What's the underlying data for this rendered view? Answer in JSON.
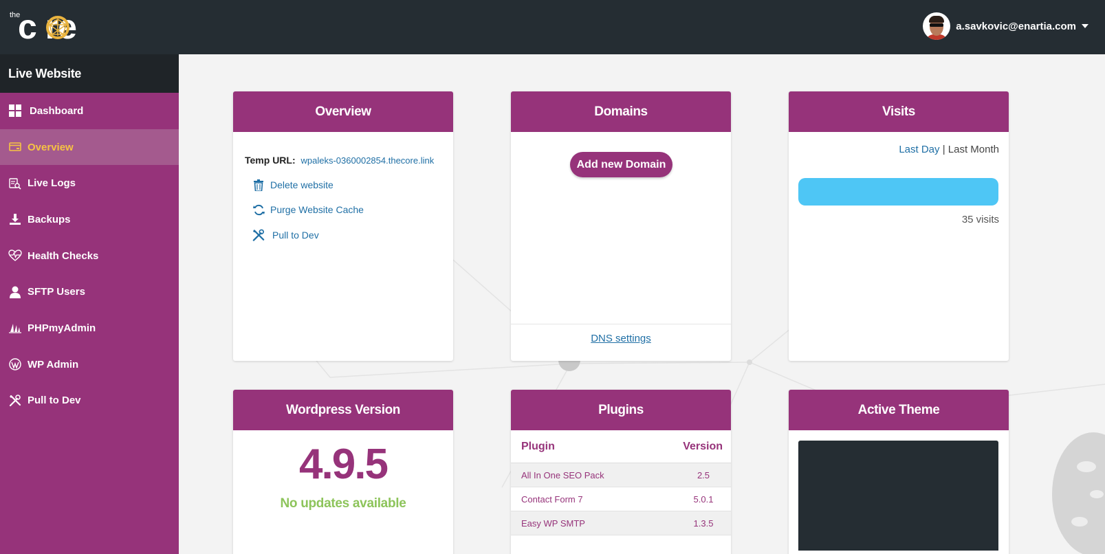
{
  "header": {
    "logo_the": "the",
    "logo_word": "c re",
    "user_email": "a.savkovic@enartia.com"
  },
  "sidebar": {
    "title": "Live Website",
    "items": [
      {
        "label": "Dashboard",
        "icon": "dashboard-grid-icon"
      },
      {
        "label": "Overview",
        "icon": "credit-card-icon",
        "active": true
      },
      {
        "label": "Live Logs",
        "icon": "logs-search-icon"
      },
      {
        "label": "Backups",
        "icon": "download-icon"
      },
      {
        "label": "Health Checks",
        "icon": "heartbeat-icon"
      },
      {
        "label": "SFTP Users",
        "icon": "user-icon"
      },
      {
        "label": "PHPmyAdmin",
        "icon": "sailboat-icon"
      },
      {
        "label": "WP Admin",
        "icon": "wordpress-icon"
      },
      {
        "label": "Pull to Dev",
        "icon": "tools-icon"
      }
    ]
  },
  "overview": {
    "title": "Overview",
    "temp_url_label": "Temp URL:",
    "temp_url": "wpaleks-0360002854.thecore.link",
    "actions": [
      {
        "label": "Delete website",
        "icon": "trash-icon"
      },
      {
        "label": "Purge Website Cache",
        "icon": "refresh-icon"
      },
      {
        "label": "Pull to Dev",
        "icon": "tools-icon"
      }
    ]
  },
  "domains": {
    "title": "Domains",
    "add_button": "Add new Domain",
    "dns_link": "DNS settings"
  },
  "visits": {
    "title": "Visits",
    "tab_day": "Last Day",
    "separator": "|",
    "tab_month": "Last Month",
    "count_text": "35 visits",
    "bar_fill": 1.0,
    "bar_color": "#4ec6f5"
  },
  "wordpress": {
    "title": "Wordpress Version",
    "version": "4.9.5",
    "status": "No updates available"
  },
  "plugins": {
    "title": "Plugins",
    "col_plugin": "Plugin",
    "col_version": "Version",
    "rows": [
      {
        "name": "All In One SEO Pack",
        "version": "2.5"
      },
      {
        "name": "Contact Form 7",
        "version": "5.0.1"
      },
      {
        "name": "Easy WP SMTP",
        "version": "1.3.5"
      }
    ]
  },
  "theme": {
    "title": "Active Theme"
  },
  "colors": {
    "brand_purple": "#96337a",
    "topbar_dark": "#252d33",
    "active_yellow": "#f6c343",
    "link_blue": "#1f6fa5",
    "success_green": "#8dc45b"
  }
}
